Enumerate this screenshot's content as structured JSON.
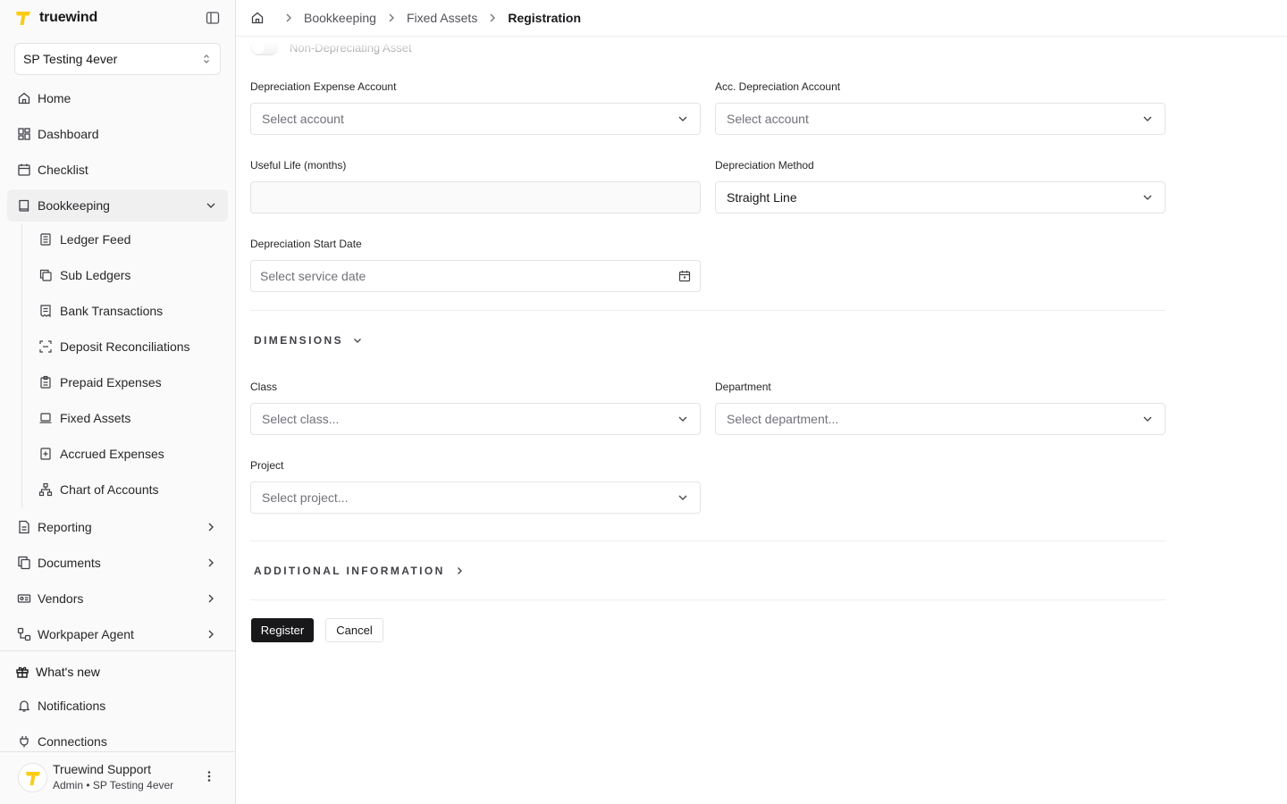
{
  "brand": {
    "name": "truewind",
    "accent": "#FACC15"
  },
  "org_selector": {
    "value": "SP Testing 4ever"
  },
  "nav": {
    "home": "Home",
    "dashboard": "Dashboard",
    "checklist": "Checklist",
    "bookkeeping": "Bookkeeping",
    "bookkeeping_items": {
      "ledger_feed": "Ledger Feed",
      "sub_ledgers": "Sub Ledgers",
      "bank_transactions": "Bank Transactions",
      "deposit_reconciliations": "Deposit Reconciliations",
      "prepaid_expenses": "Prepaid Expenses",
      "fixed_assets": "Fixed Assets",
      "accrued_expenses": "Accrued Expenses",
      "chart_of_accounts": "Chart of Accounts"
    },
    "reporting": "Reporting",
    "documents": "Documents",
    "vendors": "Vendors",
    "workpaper_agent": "Workpaper Agent",
    "whats_new": "What's new",
    "notifications": "Notifications",
    "connections": "Connections"
  },
  "user": {
    "name": "Truewind Support",
    "role": "Admin • SP Testing 4ever"
  },
  "breadcrumb": {
    "level1": "Bookkeeping",
    "level2": "Fixed Assets",
    "current": "Registration"
  },
  "form": {
    "non_depreciating": {
      "label": "Non-Depreciating Asset",
      "checked": false
    },
    "depreciation_expense_account": {
      "label": "Depreciation Expense Account",
      "placeholder": "Select account"
    },
    "acc_depreciation_account": {
      "label": "Acc. Depreciation Account",
      "placeholder": "Select account"
    },
    "useful_life": {
      "label": "Useful Life (months)",
      "value": ""
    },
    "depreciation_method": {
      "label": "Depreciation Method",
      "value": "Straight Line"
    },
    "depreciation_start_date": {
      "label": "Depreciation Start Date",
      "placeholder": "Select service date"
    },
    "dimensions": {
      "title": "DIMENSIONS",
      "class": {
        "label": "Class",
        "placeholder": "Select class..."
      },
      "department": {
        "label": "Department",
        "placeholder": "Select department..."
      },
      "project": {
        "label": "Project",
        "placeholder": "Select project..."
      }
    },
    "additional_information": {
      "title": "ADDITIONAL INFORMATION"
    },
    "actions": {
      "register": "Register",
      "cancel": "Cancel"
    }
  }
}
